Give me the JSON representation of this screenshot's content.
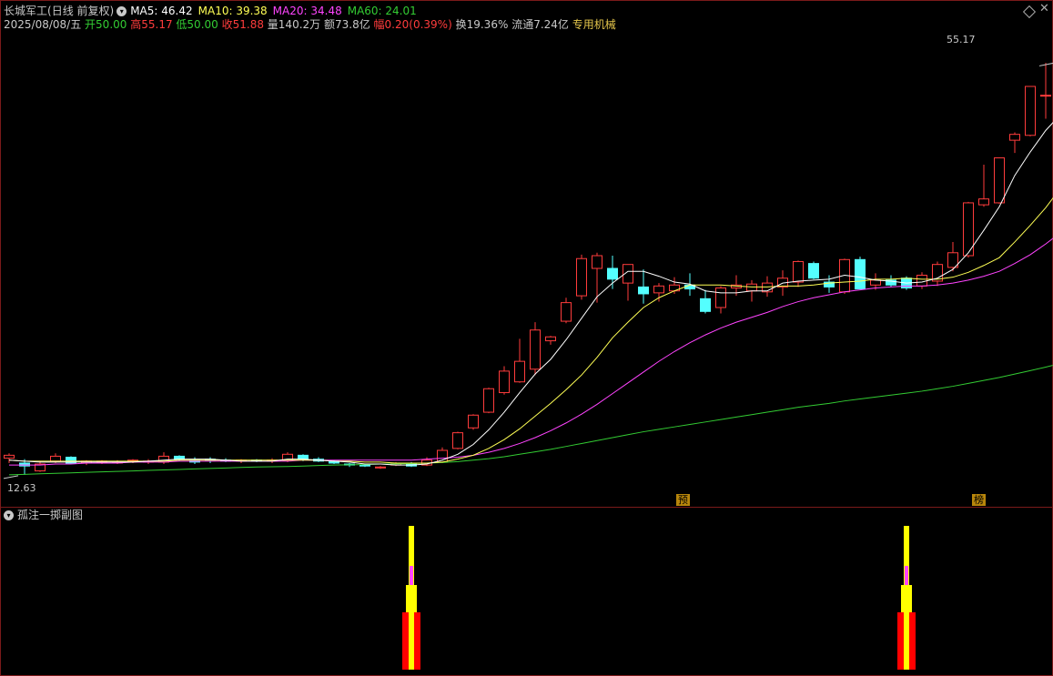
{
  "header": {
    "stock_name": "长城军工",
    "period": "(日线 前复权)",
    "ma_circle": "▾",
    "ma5": "MA5: 46.42",
    "ma10": "MA10: 39.38",
    "ma20": "MA20: 34.48",
    "ma60": "MA60: 24.01",
    "date": "2025/08/08/五",
    "open": "开50.00",
    "high": "高55.17",
    "low": "低50.00",
    "close": "收51.88",
    "volume": "量140.2万",
    "amount": "额73.8亿",
    "change": "幅0.20(0.39%)",
    "turnover": "换19.36%",
    "float_cap": "流通7.24亿",
    "sector": "专用机械"
  },
  "colors": {
    "up": "#ff3c3c",
    "down": "#54ffff",
    "ma5": "#ffffff",
    "ma10": "#ffff55",
    "ma20": "#ff44ff",
    "ma60": "#33cc33",
    "sector": "#e6c74c",
    "tag": "#b8860b"
  },
  "chart_annotations": {
    "peak_label": "55.17",
    "low_label": "12.63",
    "tag_1": "预",
    "tag_2": "榜"
  },
  "subchart": {
    "title": "孤注一掷副图",
    "circle": "▾"
  },
  "chart_data": {
    "type": "candlestick",
    "ylim": [
      11.5,
      58
    ],
    "peak_value": 55.17,
    "low_value": 12.63,
    "candles": [
      [
        14.7,
        15.2,
        14.2,
        15.0
      ],
      [
        14.2,
        14.6,
        13.0,
        13.9
      ],
      [
        13.4,
        14.4,
        13.3,
        14.1
      ],
      [
        14.4,
        15.2,
        14.2,
        14.9
      ],
      [
        14.8,
        14.9,
        14.1,
        14.2
      ],
      [
        14.2,
        14.5,
        14.0,
        14.4
      ],
      [
        14.3,
        14.5,
        14.1,
        14.4
      ],
      [
        14.3,
        14.5,
        14.1,
        14.3
      ],
      [
        14.4,
        14.6,
        14.2,
        14.5
      ],
      [
        14.3,
        14.6,
        14.1,
        14.4
      ],
      [
        14.3,
        15.3,
        14.1,
        14.9
      ],
      [
        14.9,
        15.0,
        14.4,
        14.6
      ],
      [
        14.5,
        14.8,
        14.1,
        14.3
      ],
      [
        14.6,
        14.8,
        14.2,
        14.5
      ],
      [
        14.5,
        14.7,
        14.3,
        14.4
      ],
      [
        14.4,
        14.6,
        14.2,
        14.5
      ],
      [
        14.5,
        14.6,
        14.3,
        14.4
      ],
      [
        14.4,
        14.7,
        14.2,
        14.5
      ],
      [
        14.5,
        15.3,
        14.3,
        15.1
      ],
      [
        15.0,
        15.1,
        14.4,
        14.6
      ],
      [
        14.6,
        14.8,
        14.3,
        14.4
      ],
      [
        14.4,
        14.5,
        14.1,
        14.2
      ],
      [
        14.1,
        14.2,
        13.8,
        14.0
      ],
      [
        14.0,
        14.1,
        13.8,
        13.9
      ],
      [
        13.7,
        13.9,
        13.6,
        13.8
      ],
      [
        14.0,
        14.3,
        13.9,
        14.2
      ],
      [
        14.1,
        14.3,
        13.8,
        13.9
      ],
      [
        14.0,
        14.8,
        13.9,
        14.5
      ],
      [
        14.3,
        15.8,
        14.2,
        15.5
      ],
      [
        15.7,
        17.4,
        15.6,
        17.3
      ],
      [
        17.8,
        19.2,
        17.6,
        19.1
      ],
      [
        19.4,
        21.9,
        19.3,
        21.8
      ],
      [
        21.4,
        24.1,
        21.2,
        23.6
      ],
      [
        22.5,
        26.9,
        22.4,
        24.6
      ],
      [
        23.8,
        28.6,
        23.2,
        27.8
      ],
      [
        26.7,
        27.2,
        26.3,
        27.1
      ],
      [
        28.7,
        31.1,
        28.5,
        30.6
      ],
      [
        31.3,
        35.5,
        30.9,
        35.1
      ],
      [
        34.1,
        35.7,
        30.6,
        35.4
      ],
      [
        34.1,
        35.4,
        32.0,
        33.0
      ],
      [
        32.6,
        34.5,
        30.8,
        34.5
      ],
      [
        32.2,
        34.0,
        30.5,
        31.5
      ],
      [
        31.6,
        32.6,
        30.7,
        32.3
      ],
      [
        31.8,
        33.2,
        31.5,
        32.4
      ],
      [
        32.4,
        33.6,
        31.3,
        32.0
      ],
      [
        31.0,
        31.9,
        29.5,
        29.7
      ],
      [
        30.1,
        32.3,
        29.5,
        32.1
      ],
      [
        32.1,
        33.4,
        31.3,
        32.4
      ],
      [
        31.8,
        32.9,
        30.7,
        32.5
      ],
      [
        31.7,
        33.3,
        31.2,
        32.6
      ],
      [
        32.2,
        33.9,
        31.3,
        33.1
      ],
      [
        32.7,
        34.9,
        32.2,
        34.8
      ],
      [
        34.6,
        34.8,
        33.0,
        33.1
      ],
      [
        32.7,
        33.4,
        31.6,
        32.2
      ],
      [
        31.7,
        35.1,
        31.5,
        35.0
      ],
      [
        35.0,
        35.3,
        32.0,
        32.0
      ],
      [
        32.4,
        33.6,
        31.9,
        32.9
      ],
      [
        32.9,
        33.4,
        32.2,
        32.4
      ],
      [
        33.1,
        33.3,
        31.9,
        32.1
      ],
      [
        32.3,
        33.7,
        32.0,
        33.4
      ],
      [
        32.8,
        34.8,
        32.3,
        34.5
      ],
      [
        34.2,
        36.8,
        33.8,
        35.7
      ],
      [
        35.4,
        40.9,
        35.2,
        40.8
      ],
      [
        40.6,
        44.7,
        40.4,
        41.2
      ],
      [
        40.8,
        45.4,
        40.7,
        45.4
      ],
      [
        47.2,
        48.0,
        45.9,
        47.8
      ],
      [
        47.7,
        52.7,
        47.6,
        52.7
      ],
      [
        51.8,
        55.1,
        49.4,
        51.8
      ],
      [
        50.0,
        55.17,
        50.0,
        51.88
      ]
    ],
    "ma5": [
      14.5,
      14.4,
      14.3,
      14.3,
      14.3,
      14.3,
      14.3,
      14.3,
      14.3,
      14.4,
      14.5,
      14.6,
      14.6,
      14.6,
      14.5,
      14.4,
      14.4,
      14.4,
      14.6,
      14.6,
      14.5,
      14.4,
      14.3,
      14.1,
      14.1,
      14.0,
      14.0,
      14.1,
      14.5,
      15.1,
      16.1,
      17.6,
      19.4,
      21.4,
      23.3,
      24.8,
      26.8,
      29.0,
      31.2,
      32.6,
      33.8,
      33.8,
      33.3,
      32.7,
      32.5,
      31.8,
      31.6,
      31.6,
      31.8,
      31.8,
      32.6,
      32.8,
      32.9,
      33.0,
      33.4,
      33.2,
      32.9,
      32.8,
      32.6,
      32.7,
      33.1,
      34.0,
      35.7,
      38.0,
      40.4,
      43.6,
      46.0,
      48.2,
      49.9
    ],
    "ma10": [
      14.5,
      14.4,
      14.4,
      14.4,
      14.4,
      14.4,
      14.4,
      14.4,
      14.4,
      14.4,
      14.4,
      14.5,
      14.5,
      14.5,
      14.5,
      14.5,
      14.5,
      14.5,
      14.5,
      14.5,
      14.5,
      14.4,
      14.4,
      14.3,
      14.3,
      14.2,
      14.2,
      14.2,
      14.3,
      14.6,
      15.0,
      15.7,
      16.6,
      17.7,
      19.0,
      20.3,
      21.7,
      23.2,
      25.0,
      27.0,
      28.6,
      30.1,
      31.1,
      31.8,
      32.4,
      32.4,
      32.4,
      32.3,
      32.2,
      32.2,
      32.3,
      32.3,
      32.4,
      32.6,
      32.7,
      32.8,
      33.0,
      33.0,
      33.1,
      33.0,
      33.0,
      33.2,
      33.7,
      34.4,
      35.2,
      36.8,
      38.5,
      40.3,
      42.4
    ],
    "ma20": [
      14.0,
      14.0,
      14.0,
      14.1,
      14.1,
      14.2,
      14.2,
      14.2,
      14.3,
      14.3,
      14.3,
      14.4,
      14.4,
      14.4,
      14.4,
      14.4,
      14.4,
      14.4,
      14.4,
      14.5,
      14.5,
      14.5,
      14.5,
      14.5,
      14.5,
      14.5,
      14.5,
      14.6,
      14.7,
      14.8,
      15.0,
      15.3,
      15.7,
      16.2,
      16.8,
      17.5,
      18.3,
      19.2,
      20.2,
      21.3,
      22.4,
      23.5,
      24.6,
      25.6,
      26.5,
      27.3,
      28.0,
      28.6,
      29.1,
      29.6,
      30.2,
      30.7,
      31.1,
      31.4,
      31.7,
      31.9,
      32.1,
      32.2,
      32.3,
      32.3,
      32.4,
      32.6,
      32.9,
      33.3,
      33.8,
      34.6,
      35.5,
      36.6,
      37.8
    ],
    "ma60": [
      13.0,
      13.05,
      13.1,
      13.15,
      13.2,
      13.25,
      13.3,
      13.35,
      13.4,
      13.45,
      13.5,
      13.55,
      13.6,
      13.65,
      13.7,
      13.75,
      13.8,
      13.82,
      13.85,
      13.9,
      13.95,
      14.0,
      14.02,
      14.05,
      14.1,
      14.12,
      14.15,
      14.2,
      14.25,
      14.35,
      14.5,
      14.65,
      14.85,
      15.1,
      15.35,
      15.6,
      15.9,
      16.2,
      16.5,
      16.8,
      17.1,
      17.4,
      17.65,
      17.9,
      18.15,
      18.4,
      18.65,
      18.9,
      19.15,
      19.4,
      19.65,
      19.9,
      20.1,
      20.3,
      20.55,
      20.75,
      20.95,
      21.15,
      21.35,
      21.55,
      21.8,
      22.05,
      22.35,
      22.65,
      22.95,
      23.3,
      23.65,
      24.01,
      24.4
    ],
    "indicator_bars": [
      {
        "candle_index": 26,
        "red": 1.0,
        "yellow": 1.0,
        "magenta": 0.6
      },
      {
        "candle_index": 58,
        "red": 1.0,
        "yellow": 1.0,
        "magenta": 0.6
      }
    ]
  }
}
